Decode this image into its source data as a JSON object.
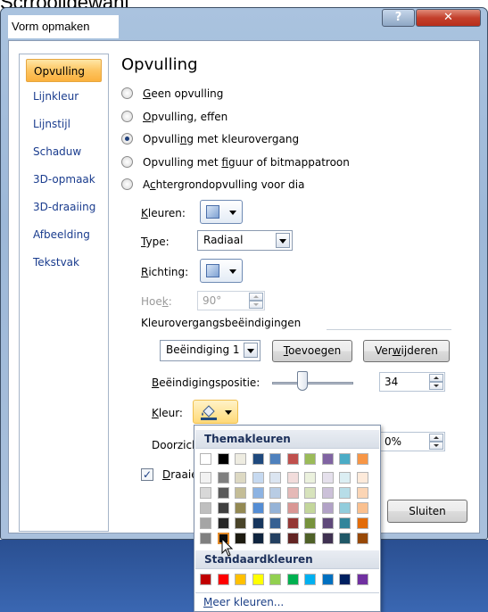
{
  "top_fragment": "Scrrooligewant",
  "window": {
    "title": "Vorm opmaken",
    "help_label": "?",
    "close_label": "✕"
  },
  "sidebar": {
    "items": [
      {
        "label": "Opvulling",
        "active": true
      },
      {
        "label": "Lijnkleur"
      },
      {
        "label": "Lijnstijl"
      },
      {
        "label": "Schaduw"
      },
      {
        "label": "3D-opmaak"
      },
      {
        "label": "3D-draaiing"
      },
      {
        "label": "Afbeelding"
      },
      {
        "label": "Tekstvak"
      }
    ]
  },
  "panel": {
    "heading": "Opvulling",
    "options": [
      {
        "pre": "",
        "u": "G",
        "post": "een opvulling",
        "checked": false
      },
      {
        "pre": "",
        "u": "O",
        "post": "pvulling, effen",
        "checked": false
      },
      {
        "pre": "Opvulli",
        "u": "n",
        "post": "g met kleurovergang",
        "checked": true
      },
      {
        "pre": "Opvulling met ",
        "u": "f",
        "post": "iguur of bitmappatroon",
        "checked": false
      },
      {
        "pre": "A",
        "u": "c",
        "post": "htergrondopvulling voor dia",
        "checked": false
      }
    ],
    "kleuren_label": {
      "pre": "",
      "u": "K",
      "post": "leuren:"
    },
    "type_label": {
      "pre": "",
      "u": "T",
      "post": "ype:"
    },
    "type_value": "Radiaal",
    "richting_label": {
      "pre": "",
      "u": "R",
      "post": "ichting:"
    },
    "hoek_label": {
      "pre": "Hoe",
      "u": "k",
      "post": ":"
    },
    "hoek_value": "90°",
    "section_label": "Kleurovergangsbeëindigingen",
    "stop_select": "Beëindiging 1",
    "add_button": {
      "pre": "",
      "u": "T",
      "post": "oevoegen"
    },
    "remove_button": {
      "pre": "Ver",
      "u": "w",
      "post": "ijderen"
    },
    "position_label": {
      "pre": "",
      "u": "B",
      "post": "eëindigingspositie:"
    },
    "position_value": "34",
    "kleur_label": {
      "pre": "",
      "u": "K",
      "post": "leur:"
    },
    "doorzicht_label": "Doorzich",
    "doorzicht_value": "0%",
    "rotate_checkbox_label": {
      "pre": "",
      "u": "D",
      "post": "raaie"
    },
    "rotate_checked": true,
    "close_button": "Sluiten"
  },
  "color_popup": {
    "theme_header": "Themakleuren",
    "standard_header": "Standaardkleuren",
    "more_colors": {
      "pre": "",
      "u": "M",
      "post": "eer kleuren..."
    },
    "theme_top_row": [
      "#ffffff",
      "#000000",
      "#eeece1",
      "#1f497d",
      "#4f81bd",
      "#c0504d",
      "#9bbb59",
      "#8064a2",
      "#4bacc6",
      "#f79646"
    ],
    "theme_shades": [
      [
        "#f2f2f2",
        "#7f7f7f",
        "#ddd9c3",
        "#c6d9f0",
        "#dbe5f1",
        "#f2dcdb",
        "#ebf1dd",
        "#e5e0ec",
        "#dbeef3",
        "#fdeada"
      ],
      [
        "#d8d8d8",
        "#595959",
        "#c4bd97",
        "#8db3e2",
        "#b8cce4",
        "#e5b9b7",
        "#d7e3bc",
        "#ccc1d9",
        "#b7dde8",
        "#fbd5b5"
      ],
      [
        "#bfbfbf",
        "#3f3f3f",
        "#938953",
        "#548dd4",
        "#95b3d7",
        "#d99694",
        "#c3d69b",
        "#b2a2c7",
        "#92cddc",
        "#fac08f"
      ],
      [
        "#a5a5a5",
        "#262626",
        "#494429",
        "#17365d",
        "#366092",
        "#953734",
        "#76923c",
        "#5f497a",
        "#31859b",
        "#e36c09"
      ],
      [
        "#7f7f7f",
        "#0c0c0c",
        "#1d1b10",
        "#0f243e",
        "#244061",
        "#632423",
        "#4f6128",
        "#3f3151",
        "#205867",
        "#974806"
      ]
    ],
    "selected_shade": {
      "row": 4,
      "col": 1
    },
    "standard_colors": [
      "#c00000",
      "#ff0000",
      "#ffc000",
      "#ffff00",
      "#92d050",
      "#00b050",
      "#00b0f0",
      "#0070c0",
      "#002060",
      "#7030a0"
    ]
  }
}
